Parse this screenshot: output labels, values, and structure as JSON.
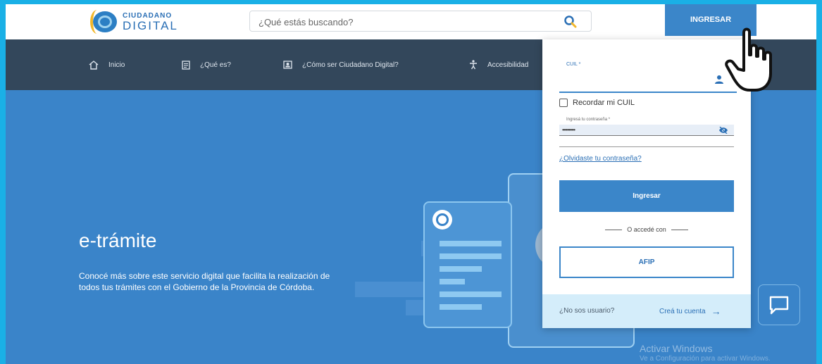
{
  "header": {
    "logo_top": "CIUDADANO",
    "logo_bottom": "DIGITAL",
    "search_placeholder": "¿Qué estás buscando?",
    "search_icon": "search-icon",
    "login_button": "INGRESAR"
  },
  "nav": {
    "items": [
      {
        "label": "Inicio",
        "icon": "home-icon"
      },
      {
        "label": "¿Qué es?",
        "icon": "document-icon"
      },
      {
        "label": "¿Cómo ser Ciudadano Digital?",
        "icon": "id-card-icon"
      },
      {
        "label": "Accesibilidad",
        "icon": "accessibility-icon"
      }
    ]
  },
  "hero": {
    "title": "e-trámite",
    "description": "Conocé más sobre este servicio digital que facilita la realización de todos tus trámites con el Gobierno de la Provincia de Córdoba."
  },
  "login_panel": {
    "cuil_label": "CUIL *",
    "remember_label": "Recordar mi CUIL",
    "password_label": "Ingresá tu contraseña *",
    "password_value": "••••••••••",
    "forgot_link": "¿Olvidaste tu contraseña?",
    "submit_label": "Ingresar",
    "separator": "O accedé con",
    "afip_label": "AFIP",
    "no_user": "¿No sos usuario?",
    "create_account": "Creá tu cuenta",
    "create_arrow": "→"
  },
  "watermark": {
    "title": "Activar Windows",
    "subtitle": "Ve a Configuración para activar Windows."
  },
  "colors": {
    "primary": "#3b86c9",
    "nav_bg": "#33475b",
    "hero_bg": "#3a84c9",
    "frame_border": "#1ab0e6"
  }
}
